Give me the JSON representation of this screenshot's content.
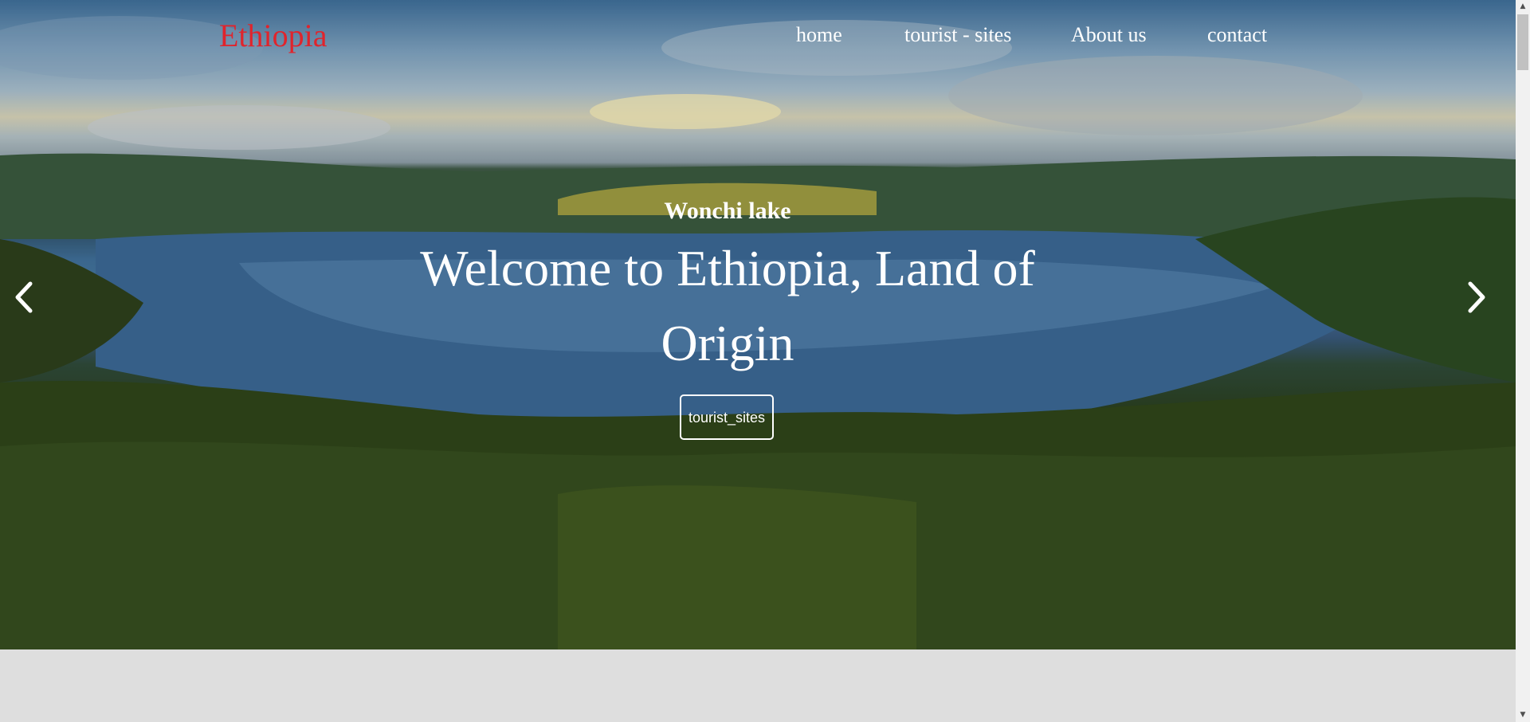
{
  "brand": "Ethiopia",
  "nav": {
    "home": "home",
    "tourist_sites": "tourist - sites",
    "about": "About us",
    "contact": "contact"
  },
  "slide": {
    "subtitle": "Wonchi lake",
    "title_line1": "Welcome to Ethiopia, Land of",
    "title_line2": "Origin",
    "button": "tourist_sites"
  },
  "controls": {
    "prev_icon": "chevron-left-icon",
    "next_icon": "chevron-right-icon"
  },
  "colors": {
    "brand": "#e0242c",
    "nav_text": "#ffffff",
    "page_background": "#dedede"
  }
}
